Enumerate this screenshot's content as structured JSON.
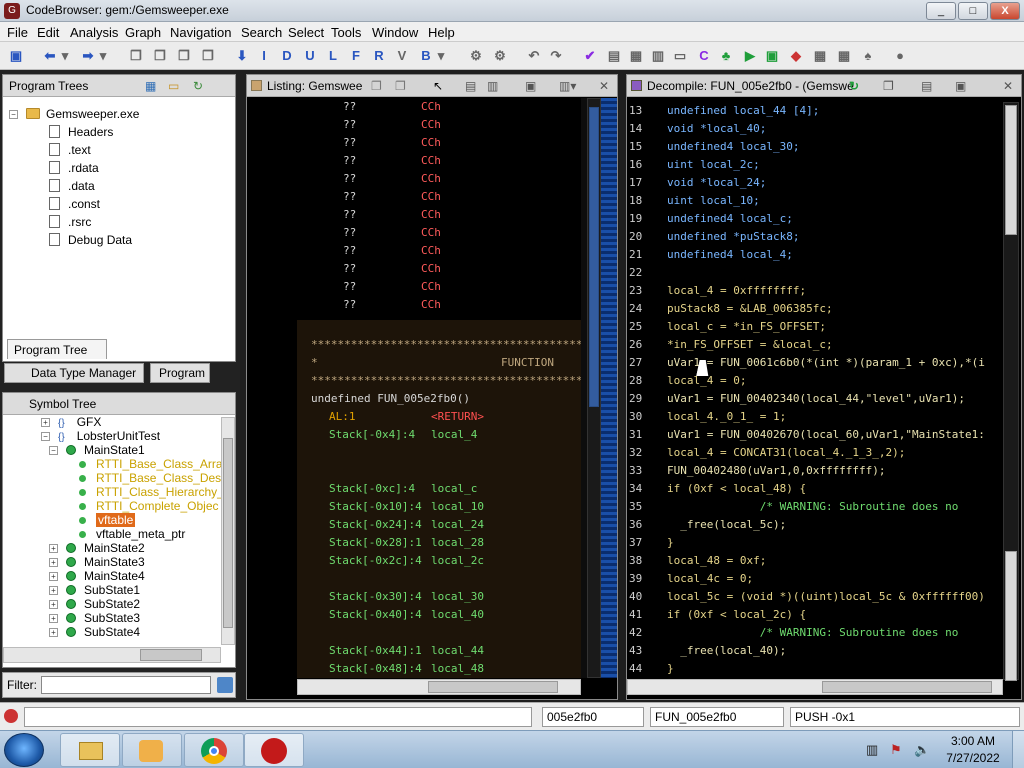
{
  "window": {
    "title": "CodeBrowser: gem:/Gemsweeper.exe",
    "min": "_",
    "max": "□",
    "close": "X"
  },
  "menu": [
    "File",
    "Edit",
    "Analysis",
    "Graph",
    "Navigation",
    "Search",
    "Select",
    "Tools",
    "Window",
    "Help"
  ],
  "toolbar": {
    "nav_letters": [
      "I",
      "D",
      "U",
      "L",
      "F",
      "R",
      "V",
      "B"
    ]
  },
  "program_trees": {
    "title": "Program Trees",
    "root": "Gemsweeper.exe",
    "items": [
      "Headers",
      ".text",
      ".rdata",
      ".data",
      ".const",
      ".rsrc",
      "Debug Data"
    ],
    "tab": "Program Tree"
  },
  "data_type_tabs": [
    "Data Type Manager",
    "Program T"
  ],
  "symbol_tree": {
    "title": "Symbol Tree",
    "rows": [
      {
        "label": "GFX",
        "kind": "ns"
      },
      {
        "label": "LobsterUnitTest",
        "kind": "ns"
      },
      {
        "label": "MainState1",
        "kind": "cls"
      },
      {
        "label": "RTTI_Base_Class_Arra",
        "kind": "leaf"
      },
      {
        "label": "RTTI_Base_Class_Desc",
        "kind": "leaf"
      },
      {
        "label": "RTTI_Class_Hierarchy_",
        "kind": "leaf"
      },
      {
        "label": "RTTI_Complete_Objec",
        "kind": "leaf"
      },
      {
        "label": "vftable",
        "kind": "sel"
      },
      {
        "label": "vftable_meta_ptr",
        "kind": "leaf2"
      },
      {
        "label": "MainState2",
        "kind": "cls"
      },
      {
        "label": "MainState3",
        "kind": "cls"
      },
      {
        "label": "MainState4",
        "kind": "cls"
      },
      {
        "label": "SubState1",
        "kind": "cls"
      },
      {
        "label": "SubState2",
        "kind": "cls"
      },
      {
        "label": "SubState3",
        "kind": "cls"
      },
      {
        "label": "SubState4",
        "kind": "cls"
      }
    ],
    "filter_label": "Filter:"
  },
  "listing": {
    "title": "Listing:  Gemswee",
    "bytes": [
      "??",
      "??",
      "??",
      "??",
      "??",
      "??",
      "??",
      "??",
      "??",
      "??",
      "??",
      "??"
    ],
    "byte_vals": [
      "CCh",
      "CCh",
      "CCh",
      "CCh",
      "CCh",
      "CCh",
      "CCh",
      "CCh",
      "CCh",
      "CCh",
      "CCh",
      "CCh"
    ],
    "stars": "**************************************************",
    "function_label": "FUNCTION",
    "signature": "undefined FUN_005e2fb0()",
    "ret_reg": "AL:1",
    "ret_val": "<RETURN>",
    "vars": [
      [
        "Stack[-0x4]:4",
        "local_4"
      ],
      [
        "",
        ""
      ],
      [
        "",
        ""
      ],
      [
        "Stack[-0xc]:4",
        "local_c"
      ],
      [
        "Stack[-0x10]:4",
        "local_10"
      ],
      [
        "Stack[-0x24]:4",
        "local_24"
      ],
      [
        "Stack[-0x28]:1",
        "local_28"
      ],
      [
        "Stack[-0x2c]:4",
        "local_2c"
      ],
      [
        "",
        ""
      ],
      [
        "Stack[-0x30]:4",
        "local_30"
      ],
      [
        "Stack[-0x40]:4",
        "local_40"
      ],
      [
        "",
        ""
      ],
      [
        "Stack[-0x44]:1",
        "local_44"
      ],
      [
        "Stack[-0x48]:4",
        "local_48"
      ]
    ]
  },
  "decompile": {
    "title": "Decompile: FUN_005e2fb0 - (Gemswe",
    "lines": [
      {
        "n": "13",
        "t": "undefined local_44 [4];"
      },
      {
        "n": "14",
        "t": "void *local_40;"
      },
      {
        "n": "15",
        "t": "undefined4 local_30;"
      },
      {
        "n": "16",
        "t": "uint local_2c;"
      },
      {
        "n": "17",
        "t": "void *local_24;"
      },
      {
        "n": "18",
        "t": "uint local_10;"
      },
      {
        "n": "19",
        "t": "undefined4 local_c;"
      },
      {
        "n": "20",
        "t": "undefined *puStack8;"
      },
      {
        "n": "21",
        "t": "undefined4 local_4;"
      },
      {
        "n": "22",
        "t": ""
      },
      {
        "n": "23",
        "t": "local_4 = 0xffffffff;"
      },
      {
        "n": "24",
        "t": "puStack8 = &LAB_006385fc;"
      },
      {
        "n": "25",
        "t": "local_c = *in_FS_OFFSET;"
      },
      {
        "n": "26",
        "t": "*in_FS_OFFSET = &local_c;"
      },
      {
        "n": "27",
        "t": "uVar1 = FUN_0061c6b0(*(int *)(param_1 + 0xc),*(i"
      },
      {
        "n": "28",
        "t": "local_4 = 0;"
      },
      {
        "n": "29",
        "t": "uVar1 = FUN_00402340(local_44,\"level\",uVar1);"
      },
      {
        "n": "30",
        "t": "local_4._0_1_ = 1;"
      },
      {
        "n": "31",
        "t": "uVar1 = FUN_00402670(local_60,uVar1,\"MainState1:"
      },
      {
        "n": "32",
        "t": "local_4 = CONCAT31(local_4._1_3_,2);"
      },
      {
        "n": "33",
        "t": "FUN_00402480(uVar1,0,0xffffffff);"
      },
      {
        "n": "34",
        "t": "if (0xf < local_48) {"
      },
      {
        "n": "35",
        "t": "              /* WARNING: Subroutine does no"
      },
      {
        "n": "36",
        "t": "  _free(local_5c);"
      },
      {
        "n": "37",
        "t": "}"
      },
      {
        "n": "38",
        "t": "local_48 = 0xf;"
      },
      {
        "n": "39",
        "t": "local_4c = 0;"
      },
      {
        "n": "40",
        "t": "local_5c = (void *)((uint)local_5c & 0xffffff00)"
      },
      {
        "n": "41",
        "t": "if (0xf < local_2c) {"
      },
      {
        "n": "42",
        "t": "              /* WARNING: Subroutine does no"
      },
      {
        "n": "43",
        "t": "  _free(local_40);"
      },
      {
        "n": "44",
        "t": "}"
      }
    ]
  },
  "status": {
    "address": "005e2fb0",
    "function": "FUN_005e2fb0",
    "instruction": "PUSH -0x1"
  },
  "taskbar": {
    "time": "3:00 AM",
    "date": "7/27/2022"
  }
}
